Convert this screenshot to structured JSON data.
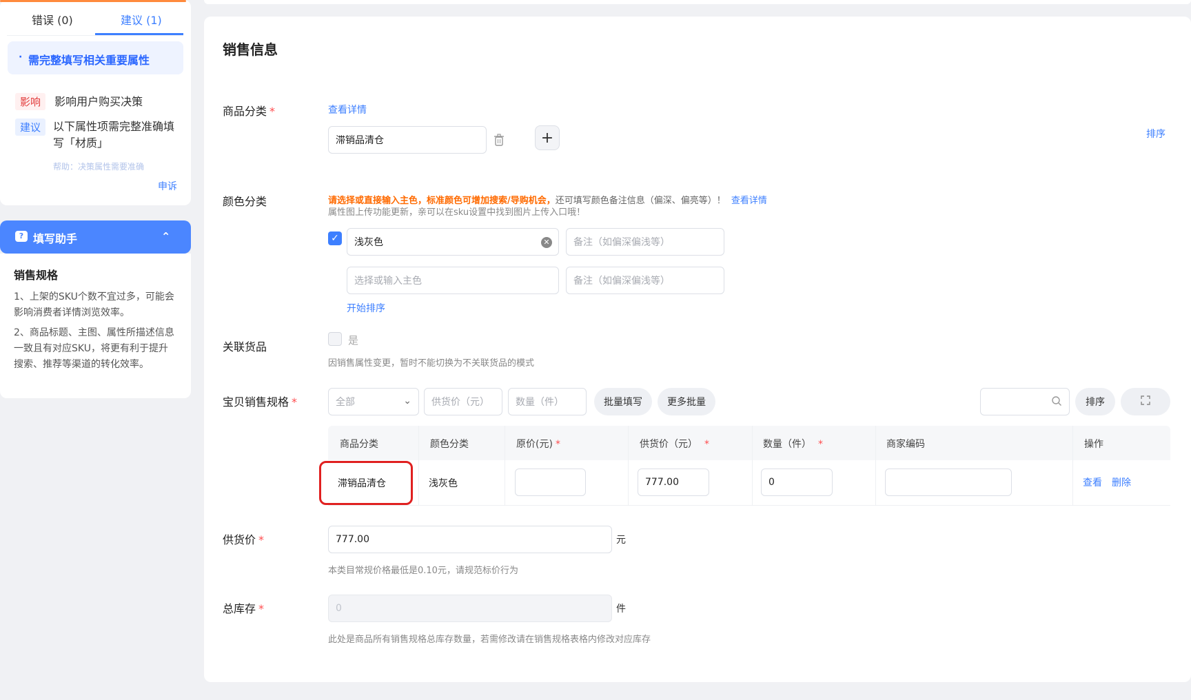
{
  "left_panel": {
    "tabs": [
      {
        "label": "错误 (0)"
      },
      {
        "label": "建议 (1)"
      }
    ],
    "suggestion_title": "需完整填写相关重要属性",
    "impact_tag": "影响",
    "impact_text": "影响用户购买决策",
    "advice_tag": "建议",
    "advice_text": "以下属性项需完整准确填写「材质」",
    "faded_text": "帮助：决策属性需要准确",
    "appeal_link": "申诉",
    "assistant": {
      "title": "填写助手",
      "section_title": "销售规格",
      "tips": [
        "1、上架的SKU个数不宜过多，可能会影响消费者详情浏览效率。",
        "2、商品标题、主图、属性所描述信息一致且有对应SKU，将更有利于提升搜索、推荐等渠道的转化效率。"
      ]
    }
  },
  "main": {
    "section_title": "销售信息",
    "category": {
      "label": "商品分类",
      "required_mark": "*",
      "view_detail": "查看详情",
      "value": "滞销品清仓",
      "add_symbol": "+",
      "sort_link": "排序"
    },
    "color": {
      "label": "颜色分类",
      "notice_orange": "请选择或直接输入主色，标准颜色可增加搜索/导购机会，",
      "notice_gray": "还可填写颜色备注信息（偏深、偏亮等）！",
      "notice_link": "查看详情",
      "notice2": "属性图上传功能更新，亲可以在sku设置中找到图片上传入口哦！",
      "row1_value": "浅灰色",
      "remark_placeholder": "备注（如偏深偏浅等）",
      "row2_placeholder": "选择或输入主色",
      "start_sort": "开始排序"
    },
    "related": {
      "label": "关联货品",
      "checkbox_label": "是",
      "hint": "因销售属性变更，暂时不能切换为不关联货品的模式"
    },
    "sku": {
      "label": "宝贝销售规格",
      "required_mark": "*",
      "filter_select": "全部",
      "price_placeholder": "供货价（元）",
      "qty_placeholder": "数量（件）",
      "batch_fill": "批量填写",
      "more_batch": "更多批量",
      "sort_button": "排序",
      "columns": [
        "商品分类",
        "颜色分类",
        "原价(元)",
        "供货价（元）",
        "数量（件）",
        "商家编码",
        "操作"
      ],
      "row": {
        "category": "滞销品清仓",
        "color": "浅灰色",
        "original_price": "",
        "supply_price": "777.00",
        "quantity": "0",
        "merchant_code": "",
        "action_view": "查看",
        "action_delete": "删除"
      }
    },
    "supply_price": {
      "label": "供货价",
      "required_mark": "*",
      "value": "777.00",
      "unit": "元",
      "hint": "本类目常规价格最低是0.10元，请规范标价行为"
    },
    "total_stock": {
      "label": "总库存",
      "required_mark": "*",
      "value": "0",
      "unit": "件",
      "hint": "此处是商品所有销售规格总库存数量，若需修改请在销售规格表格内修改对应库存"
    }
  }
}
